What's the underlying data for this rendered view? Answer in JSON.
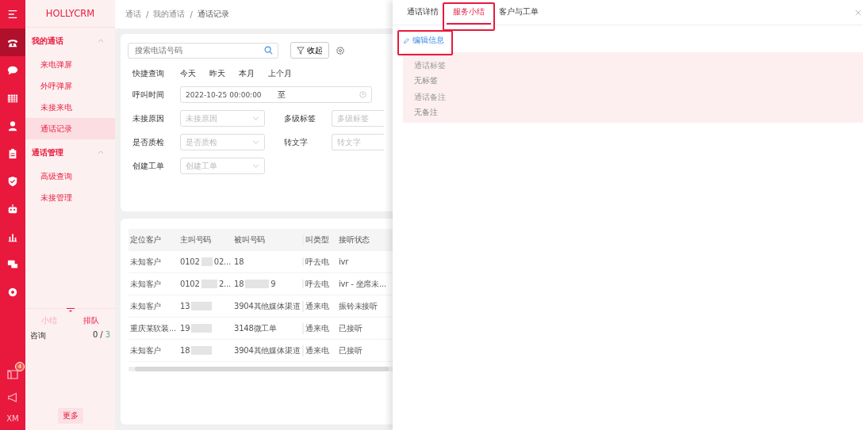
{
  "app": {
    "logo": "HOLLYCRM"
  },
  "rail": {
    "items": [
      {
        "kind": "phone",
        "selected": true
      },
      {
        "kind": "chat",
        "selected": false
      },
      {
        "kind": "grid",
        "selected": false
      },
      {
        "kind": "person",
        "selected": false
      },
      {
        "kind": "clipboard",
        "selected": false
      },
      {
        "kind": "shield",
        "selected": false
      },
      {
        "kind": "robot",
        "selected": false
      },
      {
        "kind": "chart",
        "selected": false
      },
      {
        "kind": "bubbles",
        "selected": false
      },
      {
        "kind": "gear",
        "selected": false
      }
    ],
    "badge": "4",
    "user": "XM"
  },
  "sidebar": {
    "groups": [
      {
        "label": "我的通话",
        "expanded": true,
        "children": [
          {
            "label": "来电弹屏",
            "selected": false
          },
          {
            "label": "外呼弹屏",
            "selected": false
          },
          {
            "label": "未接来电",
            "selected": false
          },
          {
            "label": "通话记录",
            "selected": true
          }
        ]
      },
      {
        "label": "通话管理",
        "expanded": true,
        "children": [
          {
            "label": "高级查询",
            "selected": false
          },
          {
            "label": "未接管理",
            "selected": false
          }
        ]
      }
    ],
    "bottom_tabs": [
      {
        "label": "小结",
        "selected": false
      },
      {
        "label": "排队",
        "selected": true
      }
    ],
    "queue": [
      {
        "name": "咨询",
        "count": "0",
        "separator": "/",
        "total": "3"
      }
    ],
    "more_button": "更多"
  },
  "breadcrumb": {
    "separator": "/",
    "items": [
      "通话",
      "我的通话",
      "通话记录"
    ]
  },
  "filters": {
    "search_placeholder": "搜索电话号码",
    "collapse_button": "收起",
    "quick_label": "快捷查询",
    "quick_options": [
      "今天",
      "昨天",
      "本月",
      "上个月"
    ],
    "time_label": "呼叫时间",
    "time_start": "2022-10-25 00:00:00",
    "time_separator": "至",
    "rows": [
      [
        {
          "label": "未接原因",
          "placeholder": "未接原因",
          "kind": "select"
        },
        {
          "label": "多级标签",
          "placeholder": "多级标签",
          "kind": "input"
        }
      ],
      [
        {
          "label": "是否质检",
          "placeholder": "是否质检",
          "kind": "select"
        },
        {
          "label": "转文字",
          "placeholder": "转文字",
          "kind": "input"
        }
      ],
      [
        {
          "label": "创建工单",
          "placeholder": "创建工单",
          "kind": "select"
        }
      ]
    ]
  },
  "table": {
    "columns": [
      "定位客户",
      "主叫号码",
      "被叫号码",
      "叫类型",
      "接听状态"
    ],
    "rows": [
      {
        "customer": "未知客户",
        "caller": [
          "0102",
          "02..."
        ],
        "callee": [
          "18"
        ],
        "type": "呼去电",
        "status": "ivr"
      },
      {
        "customer": "未知客户",
        "caller": [
          "0102",
          "2..."
        ],
        "callee": [
          "18",
          "9"
        ],
        "type": "呼去电",
        "status": "ivr - 坐席未..."
      },
      {
        "customer": "未知客户",
        "caller": [
          "13"
        ],
        "callee": [
          "3904其他媒体渠道"
        ],
        "type": "通来电",
        "status": "振铃未接听"
      },
      {
        "customer": "重庆某软装...",
        "caller": [
          "19"
        ],
        "callee": [
          "3148微工单"
        ],
        "type": "通来电",
        "status": "已接听"
      },
      {
        "customer": "未知客户",
        "caller": [
          "18"
        ],
        "callee": [
          "3904其他媒体渠道"
        ],
        "type": "通来电",
        "status": "已接听"
      }
    ]
  },
  "drawer": {
    "tabs": [
      {
        "label": "通话详情",
        "selected": false
      },
      {
        "label": "服务小结",
        "selected": true
      },
      {
        "label": "客户与工单",
        "selected": false
      }
    ],
    "edit_link": "编辑信息",
    "fields": [
      {
        "label": "通话标签",
        "value": "无标签"
      },
      {
        "label": "通话备注",
        "value": "无备注"
      }
    ]
  }
}
